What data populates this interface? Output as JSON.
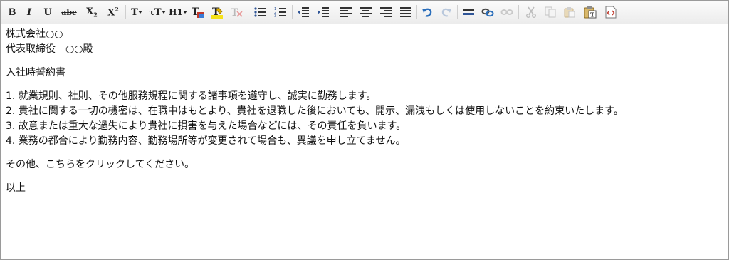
{
  "toolbar": {
    "bold": "B",
    "italic": "I",
    "underline": "U",
    "strike": "abc",
    "subscript": "X",
    "subscript_mark": "2",
    "superscript": "X",
    "superscript_mark": "2",
    "font_size": "T",
    "font_family": "T",
    "heading": "H1"
  },
  "document": {
    "header_lines": [
      "株式会社○○",
      "代表取締役　○○殿"
    ],
    "title": "入社時誓約書",
    "items": [
      "1. 就業規則、社則、その他服務規程に関する諸事項を遵守し、誠実に勤務します。",
      "2. 貴社に関する一切の機密は、在職中はもとより、貴社を退職した後においても、開示、漏洩もしくは使用しないことを約束いたします。",
      "3. 故意または重大な過失により貴社に損害を与えた場合などには、その責任を負います。",
      "4. 業務の都合により勤務内容、勤務場所等が変更されて場合も、異議を申し立てません。"
    ],
    "other_link": "その他、こちらをクリックしてください。",
    "closing": "以上"
  },
  "colors": {
    "undo_blue": "#2a6ebb",
    "highlight_yellow": "#f5e21a",
    "toolbar_bg": "#f2f2f2"
  }
}
